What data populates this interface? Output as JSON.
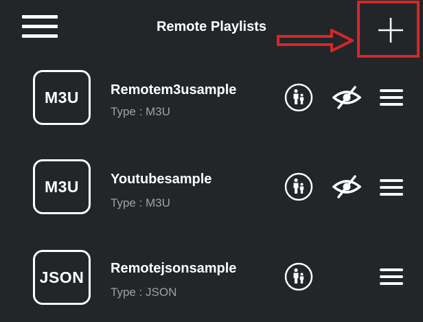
{
  "header": {
    "title": "Remote Playlists",
    "menu_icon": "hamburger-menu-icon",
    "add_icon": "plus-icon",
    "highlight_color": "#d8262a"
  },
  "playlists": [
    {
      "badge": "M3U",
      "name": "Remotem3usample",
      "type": "Type : M3U",
      "icons": [
        "parental-control-icon",
        "eye-hidden-icon",
        "hamburger-menu-icon"
      ]
    },
    {
      "badge": "M3U",
      "name": "Youtubesample",
      "type": "Type : M3U",
      "icons": [
        "parental-control-icon",
        "eye-hidden-icon",
        "hamburger-menu-icon"
      ]
    },
    {
      "badge": "JSON",
      "name": "Remotejsonsample",
      "type": "Type : JSON",
      "icons": [
        "parental-control-icon",
        "hamburger-menu-icon"
      ]
    }
  ],
  "colors": {
    "background": "#222628",
    "text": "#ffffff",
    "secondary_text": "#9da3a6"
  }
}
